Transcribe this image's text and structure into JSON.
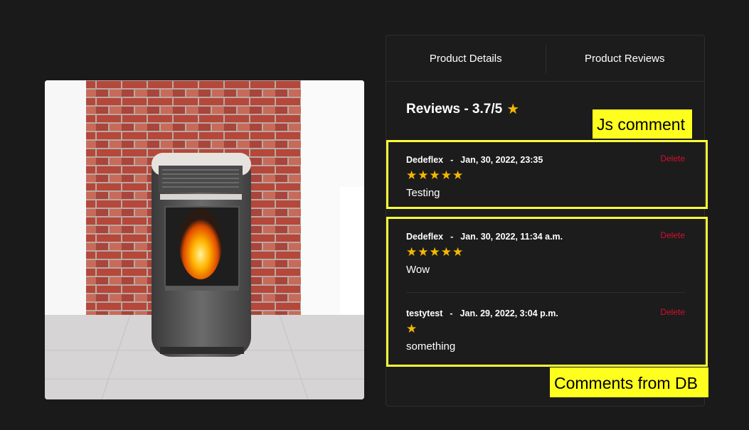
{
  "tabs": [
    {
      "label": "Product Details"
    },
    {
      "label": "Product Reviews"
    }
  ],
  "reviews_heading": "Reviews - 3.7/5",
  "annotations": {
    "js_comment": "Js comment",
    "db_comments": "Comments from DB"
  },
  "reviews": [
    {
      "author": "Dedeflex",
      "separator": "-",
      "date": "Jan, 30, 2022, 23:35",
      "stars": "★★★★★",
      "rating": 5,
      "text": "Testing",
      "delete_label": "Delete"
    },
    {
      "author": "Dedeflex",
      "separator": "-",
      "date": "Jan. 30, 2022, 11:34 a.m.",
      "stars": "★★★★★",
      "rating": 5,
      "text": "Wow",
      "delete_label": "Delete"
    },
    {
      "author": "testytest",
      "separator": "-",
      "date": "Jan. 29, 2022, 3:04 p.m.",
      "stars": "★",
      "rating": 1,
      "text": "something",
      "delete_label": "Delete"
    }
  ],
  "colors": {
    "background": "#1a1a1a",
    "star": "#f5b800",
    "delete": "#d0102f",
    "highlight": "#ffff1f"
  }
}
